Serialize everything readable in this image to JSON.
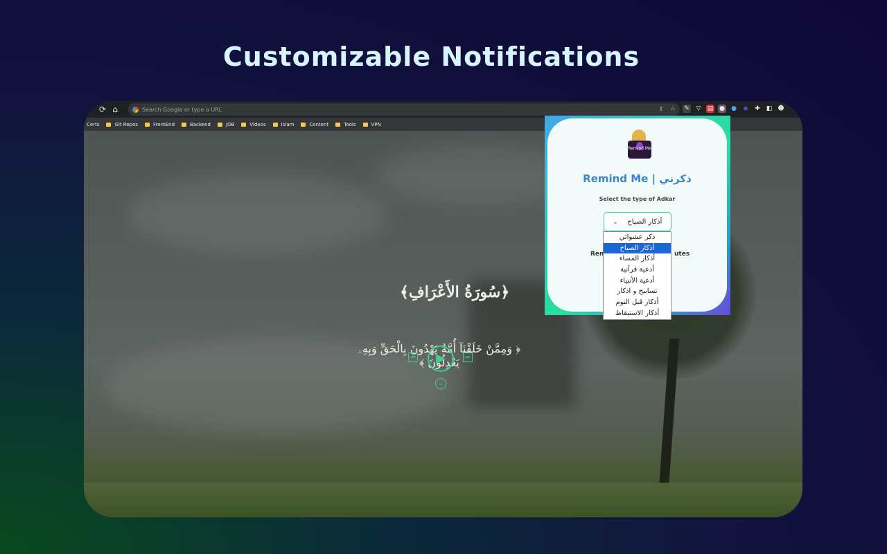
{
  "headline": "Customizable Notifications",
  "browser": {
    "url_placeholder": "Search Google or type a URL",
    "bookmarks": [
      "Certs",
      "Git Repos",
      "FrontEnd",
      "Backend",
      "JOB",
      "Videos",
      "Islam",
      "Content",
      "Tools",
      "VPN"
    ]
  },
  "page": {
    "surah": "﴿سُورَةُ الأَعْرَافِ﴾",
    "ayah": "﴿ وَمِمَّنْ خَلَقْنَآ أُمَّةٌ يَهْدُونَ بِالْحَقِّ وَبِهِۦ يَعْدِلُونَ ﴾"
  },
  "popup": {
    "logo_text": "Remind Me",
    "title": "Remind Me | ذكرني",
    "subtitle": "Select the type of Adkar",
    "selected": "أذكار الصباح",
    "remind_left": "Rem",
    "remind_right": "utes",
    "options": [
      "ذكر عشوائي",
      "أذكار الصباح",
      "أذكار المساء",
      "أدعية قرآنية",
      "أدعية الأنبياء",
      "تسابيح و اذكار",
      "أذكار قبل النوم",
      "أذكار الاستيقاظ"
    ],
    "selected_index": 1
  },
  "colors": {
    "accent": "#3ecf8e",
    "title_blue": "#3a86c8",
    "highlight": "#1a66d2"
  }
}
